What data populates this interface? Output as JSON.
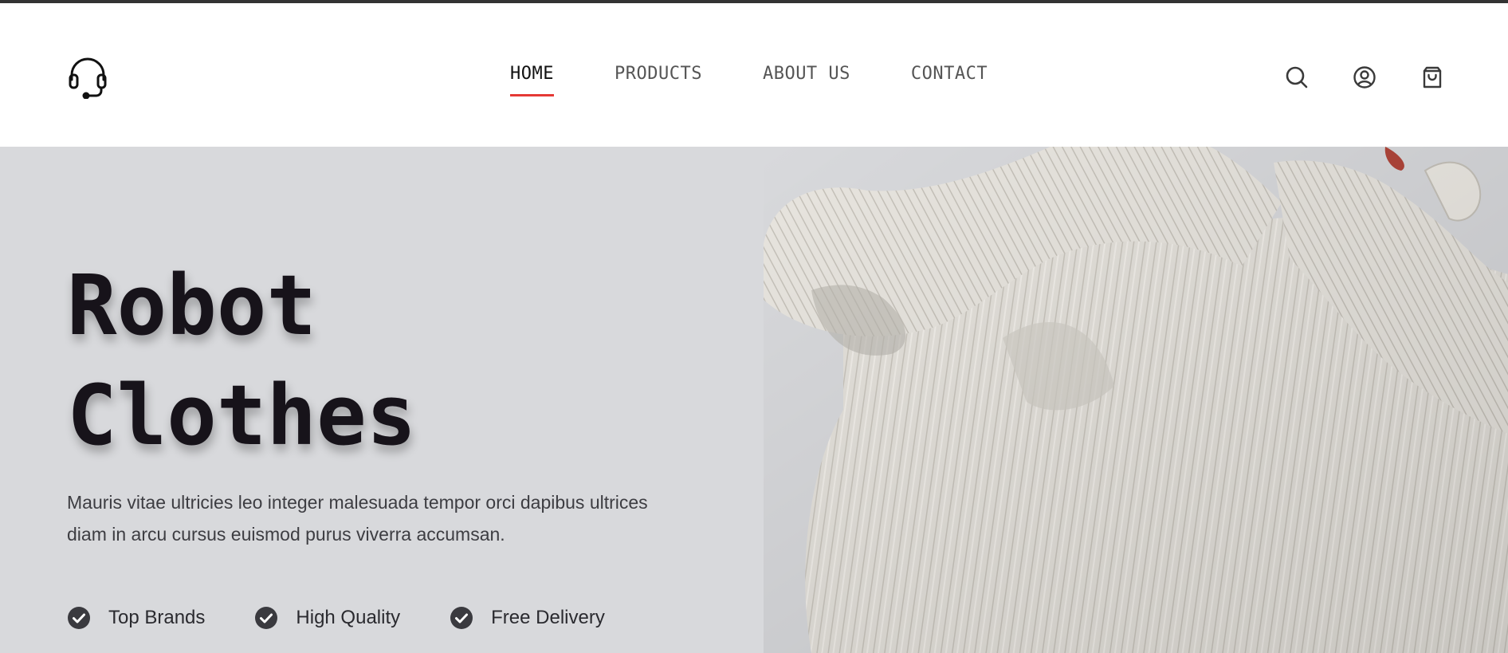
{
  "colors": {
    "accent": "#e53935",
    "hero_bg": "#d8d9dc",
    "title": "#17131a",
    "top_strip": "#333333"
  },
  "header": {
    "logo_icon": "headset-icon",
    "nav": [
      {
        "label": "HOME",
        "active": true
      },
      {
        "label": "PRODUCTS",
        "active": false
      },
      {
        "label": "ABOUT US",
        "active": false
      },
      {
        "label": "CONTACT",
        "active": false
      }
    ],
    "actions": [
      "search-icon",
      "user-circle-icon",
      "shopping-bag-icon"
    ]
  },
  "hero": {
    "title_line1": "Robot",
    "title_line2": "Clothes",
    "description": "Mauris vitae ultricies leo integer malesuada tempor orci dapibus ultrices diam in arcu cursus euismod purus viverra accumsan.",
    "image": "white-knit-sweater-photo",
    "features": [
      {
        "icon": "check-circle-icon",
        "label": "Top Brands"
      },
      {
        "icon": "check-circle-icon",
        "label": "High Quality"
      },
      {
        "icon": "check-circle-icon",
        "label": "Free Delivery"
      }
    ]
  }
}
